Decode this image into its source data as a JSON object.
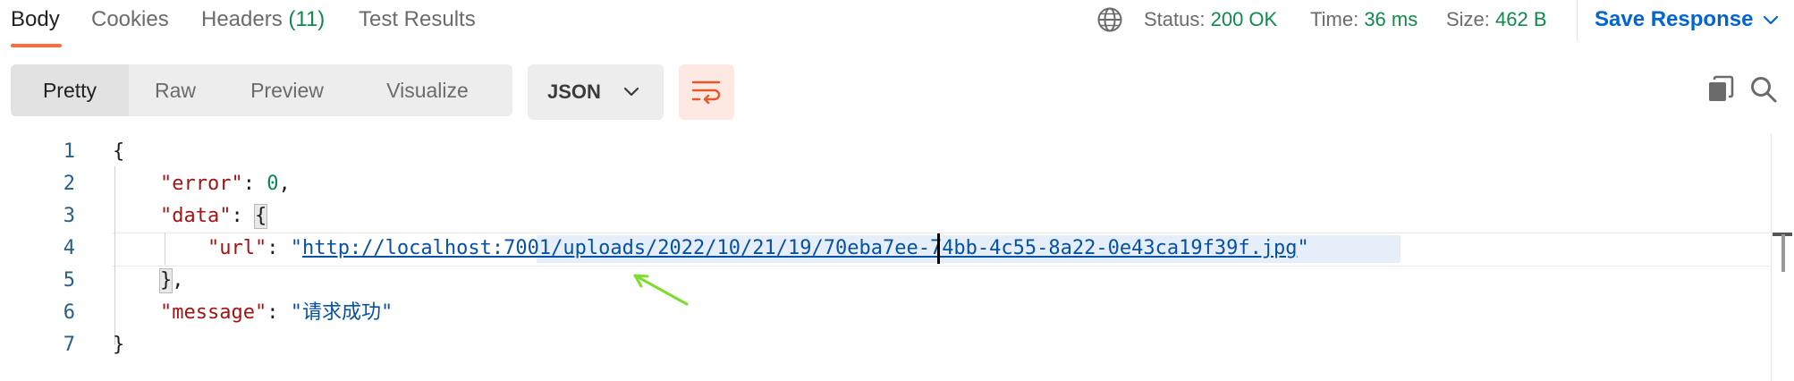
{
  "tabs": {
    "body": "Body",
    "cookies": "Cookies",
    "headers": "Headers",
    "headers_count": "(11)",
    "test_results": "Test Results"
  },
  "response_meta": {
    "status_label": "Status:",
    "status_value": "200 OK",
    "time_label": "Time:",
    "time_value": "36 ms",
    "size_label": "Size:",
    "size_value": "462 B"
  },
  "save_response": "Save Response",
  "view_modes": [
    "Pretty",
    "Raw",
    "Preview",
    "Visualize"
  ],
  "format_select": {
    "selected": "JSON"
  },
  "code": {
    "line_numbers": [
      "1",
      "2",
      "3",
      "4",
      "5",
      "6",
      "7"
    ],
    "open_brace": "{",
    "close_brace": "}",
    "error_key": "\"error\"",
    "error_value": "0",
    "data_key": "\"data\"",
    "url_key": "\"url\"",
    "url_value": "http://localhost:7001/uploads/2022/10/21/19/70eba7ee-74bb-4c55-8a22-0e43ca19f39f.jpg",
    "message_key": "\"message\"",
    "message_value": "\"请求成功\""
  },
  "colors": {
    "accent": "#ff6c37",
    "status_ok": "#0f8a4b",
    "link_blue": "#0265d2",
    "json_key": "#a31515",
    "json_string": "#0451a5",
    "json_number": "#098658",
    "annotation_arrow": "#7fdc2f"
  },
  "icons": [
    "globe-icon",
    "chevron-down-icon",
    "wrap-lines-icon",
    "copy-icon",
    "search-icon"
  ]
}
